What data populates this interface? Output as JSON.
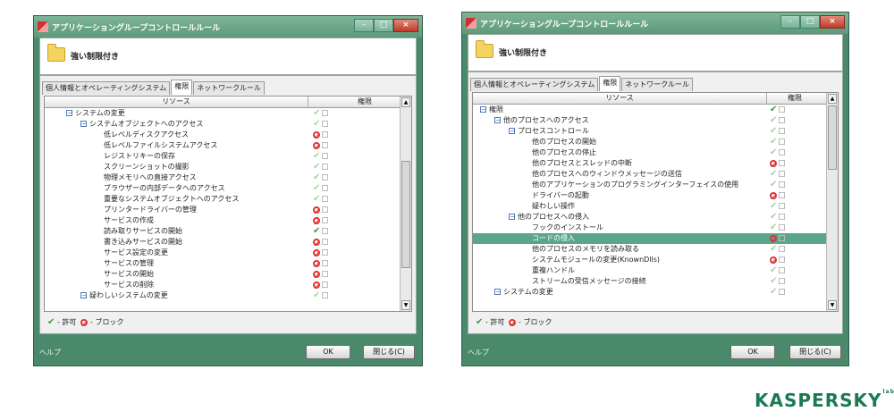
{
  "windows": [
    {
      "title": "アプリケーショングループコントロールルール",
      "profile_name": "強い制限付き",
      "tabs": [
        "個人情報とオペレーティングシステム",
        "権限",
        "ネットワークルール"
      ],
      "active_tab": 1,
      "column_resource": "リソース",
      "column_permission": "権限",
      "rows": [
        {
          "label": "システムの変更",
          "level": 1,
          "toggle": "−",
          "perm": "allow",
          "dim": true
        },
        {
          "label": "システムオブジェクトへのアクセス",
          "level": 2,
          "toggle": "−",
          "perm": "allow",
          "dim": true
        },
        {
          "label": "低レベルディスクアクセス",
          "level": 3,
          "perm": "block"
        },
        {
          "label": "低レベルファイルシステムアクセス",
          "level": 3,
          "perm": "block"
        },
        {
          "label": "レジストリキーの保存",
          "level": 3,
          "perm": "allow",
          "dim": true
        },
        {
          "label": "スクリーンショットの撮影",
          "level": 3,
          "perm": "allow",
          "dim": true
        },
        {
          "label": "物理メモリへの直接アクセス",
          "level": 3,
          "perm": "allow",
          "dim": true
        },
        {
          "label": "ブラウザーの内部データへのアクセス",
          "level": 3,
          "perm": "allow",
          "dim": true
        },
        {
          "label": "重要なシステムオブジェクトへのアクセス",
          "level": 3,
          "perm": "allow",
          "dim": true
        },
        {
          "label": "プリンタードライバーの管理",
          "level": 3,
          "perm": "block"
        },
        {
          "label": "サービスの作成",
          "level": 3,
          "perm": "block"
        },
        {
          "label": "読み取りサービスの開始",
          "level": 3,
          "perm": "allow",
          "dim": false
        },
        {
          "label": "書き込みサービスの開始",
          "level": 3,
          "perm": "block"
        },
        {
          "label": "サービス設定の変更",
          "level": 3,
          "perm": "block"
        },
        {
          "label": "サービスの管理",
          "level": 3,
          "perm": "block"
        },
        {
          "label": "サービスの開始",
          "level": 3,
          "perm": "block"
        },
        {
          "label": "サービスの削除",
          "level": 3,
          "perm": "block"
        },
        {
          "label": "疑わしいシステムの変更",
          "level": 2,
          "toggle": "−",
          "perm": "allow",
          "dim": true
        }
      ],
      "legend_allow": "- 許可",
      "legend_block": "- ブロック",
      "help": "ヘルプ",
      "ok_label": "OK",
      "close_label": "閉じる(C)"
    },
    {
      "title": "アプリケーショングループコントロールルール",
      "profile_name": "強い制限付き",
      "tabs": [
        "個人情報とオペレーティングシステム",
        "権限",
        "ネットワークルール"
      ],
      "active_tab": 1,
      "column_resource": "リソース",
      "column_permission": "権限",
      "rows": [
        {
          "label": "権限",
          "level": 0,
          "toggle": "−",
          "perm": "allow",
          "dim": false
        },
        {
          "label": "他のプロセスへのアクセス",
          "level": 1,
          "toggle": "−",
          "perm": "allow",
          "dim": true
        },
        {
          "label": "プロセスコントロール",
          "level": 2,
          "toggle": "−",
          "perm": "allow",
          "dim": true
        },
        {
          "label": "他のプロセスの開始",
          "level": 3,
          "perm": "allow",
          "dim": true
        },
        {
          "label": "他のプロセスの停止",
          "level": 3,
          "perm": "allow",
          "dim": true
        },
        {
          "label": "他のプロセスとスレッドの中断",
          "level": 3,
          "perm": "block"
        },
        {
          "label": "他のプロセスへのウィンドウメッセージの送信",
          "level": 3,
          "perm": "allow",
          "dim": true
        },
        {
          "label": "他のアプリケーションのプログラミングインターフェイスの使用",
          "level": 3,
          "perm": "allow",
          "dim": true
        },
        {
          "label": "ドライバーの起動",
          "level": 3,
          "perm": "block"
        },
        {
          "label": "疑わしい操作",
          "level": 3,
          "perm": "allow",
          "dim": true
        },
        {
          "label": "他のプロセスへの侵入",
          "level": 2,
          "toggle": "−",
          "perm": "allow",
          "dim": true
        },
        {
          "label": "フックのインストール",
          "level": 3,
          "perm": "allow",
          "dim": true
        },
        {
          "label": "コードの侵入",
          "level": 3,
          "perm": "block",
          "selected": true
        },
        {
          "label": "他のプロセスのメモリを読み取る",
          "level": 3,
          "perm": "allow",
          "dim": true
        },
        {
          "label": "システムモジュールの変更(KnownDlls)",
          "level": 3,
          "perm": "block"
        },
        {
          "label": "重複ハンドル",
          "level": 3,
          "perm": "allow",
          "dim": true
        },
        {
          "label": "ストリームの受信メッセージの接続",
          "level": 3,
          "perm": "allow",
          "dim": true
        },
        {
          "label": "システムの変更",
          "level": 1,
          "toggle": "−",
          "perm": "allow",
          "dim": true
        }
      ],
      "legend_allow": "- 許可",
      "legend_block": "- ブロック",
      "help": "ヘルプ",
      "ok_label": "OK",
      "close_label": "閉じる(C)"
    }
  ],
  "logo": {
    "text": "KASPERSKY",
    "suffix": "lab",
    "color": "#1a7a52"
  },
  "colors": {
    "window_frame": "#4a8a6a",
    "allow": "#3c9a3c",
    "block": "#dd3333",
    "selected_row": "#5aa58c"
  }
}
